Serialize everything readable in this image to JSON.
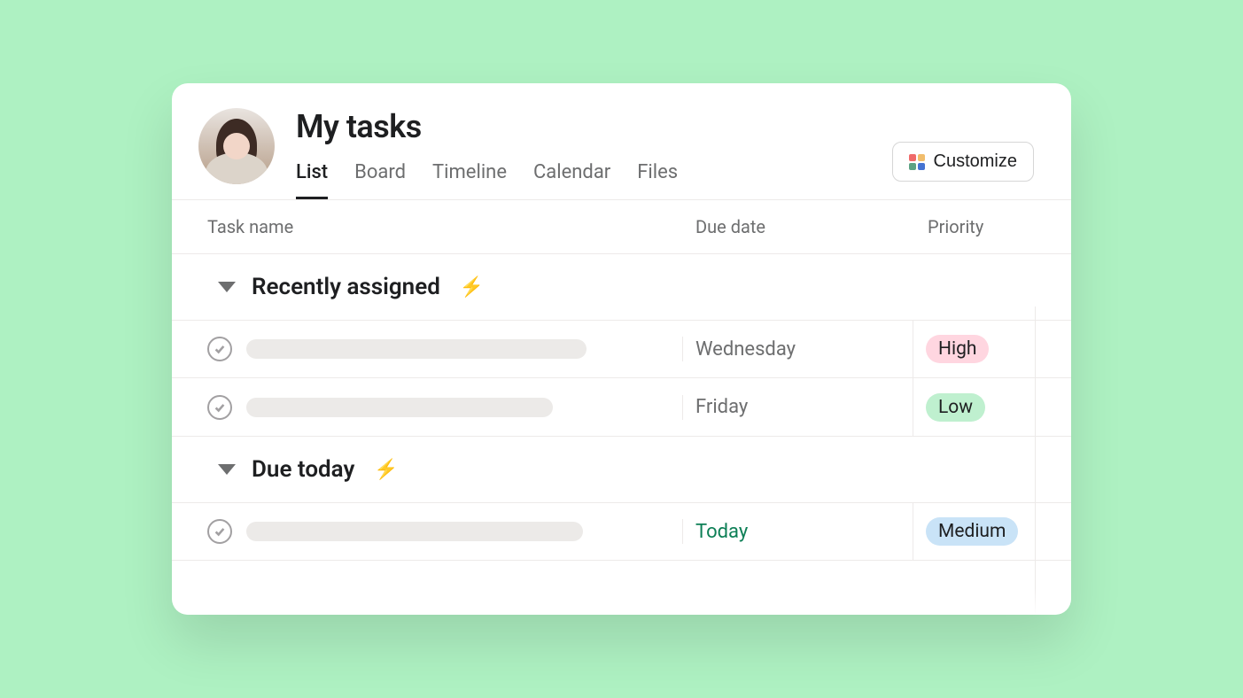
{
  "header": {
    "title": "My tasks",
    "customize_label": "Customize"
  },
  "tabs": [
    {
      "label": "List",
      "active": true
    },
    {
      "label": "Board",
      "active": false
    },
    {
      "label": "Timeline",
      "active": false
    },
    {
      "label": "Calendar",
      "active": false
    },
    {
      "label": "Files",
      "active": false
    }
  ],
  "columns": {
    "task": "Task name",
    "due": "Due date",
    "priority": "Priority"
  },
  "sections": [
    {
      "title": "Recently assigned",
      "icon": "bolt",
      "tasks": [
        {
          "due": "Wednesday",
          "due_class": "",
          "priority": "High",
          "priority_class": "pri-high",
          "placeholder_width": "384"
        },
        {
          "due": "Friday",
          "due_class": "",
          "priority": "Low",
          "priority_class": "pri-low",
          "placeholder_width": "346"
        }
      ]
    },
    {
      "title": "Due today",
      "icon": "bolt",
      "tasks": [
        {
          "due": "Today",
          "due_class": "today",
          "priority": "Medium",
          "priority_class": "pri-med",
          "placeholder_width": "380"
        }
      ]
    }
  ]
}
